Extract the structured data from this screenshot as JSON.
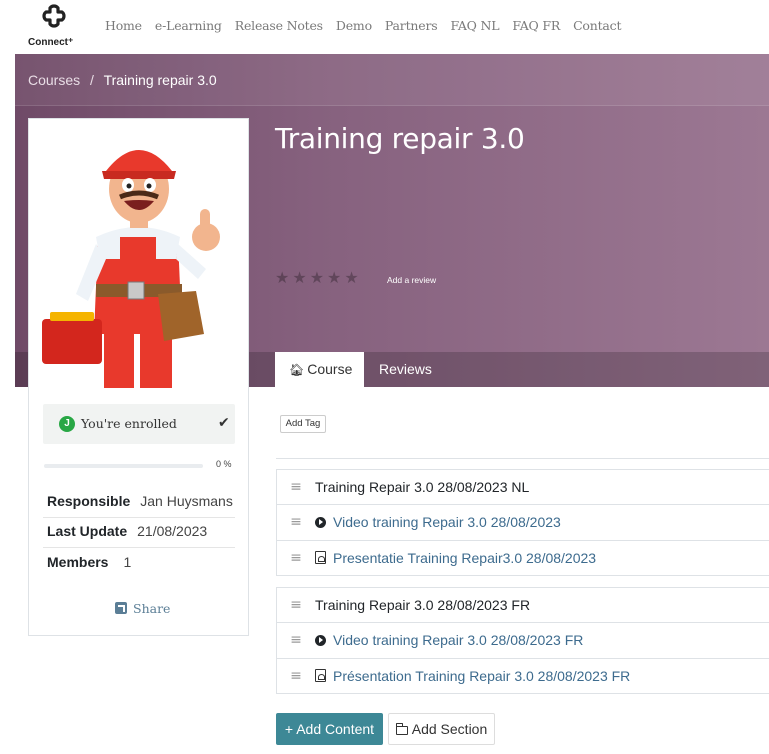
{
  "brand": {
    "logo_text": "Connect⁺"
  },
  "nav": {
    "items": [
      "Home",
      "e-Learning",
      "Release Notes",
      "Demo",
      "Partners",
      "FAQ NL",
      "FAQ FR",
      "Contact"
    ]
  },
  "breadcrumb": {
    "parent": "Courses",
    "separator": "/",
    "current": "Training repair 3.0"
  },
  "course": {
    "title": "Training repair 3.0",
    "rating_stars": 0,
    "add_review_label": "Add a review"
  },
  "tabs": {
    "course": "Course",
    "reviews": "Reviews"
  },
  "sidebar": {
    "enrolled_badge": "J",
    "enrolled_label": "You're enrolled",
    "progress_percent": 0,
    "progress_label": "0 %",
    "responsible_key": "Responsible",
    "responsible_val": "Jan Huysmans",
    "last_update_key": "Last Update",
    "last_update_val": "21/08/2023",
    "members_key": "Members",
    "members_val": "1",
    "share_label": "Share"
  },
  "content": {
    "add_tag_label": "Add Tag",
    "sections": [
      {
        "title": "Training Repair 3.0 28/08/2023 NL",
        "items": [
          {
            "type": "video",
            "icon": "play-circle-icon",
            "title": "Video training Repair 3.0 28/08/2023"
          },
          {
            "type": "pdf",
            "icon": "pdf-file-icon",
            "title": "Presentatie Training Repair3.0 28/08/2023"
          }
        ]
      },
      {
        "title": "Training Repair 3.0 28/08/2023 FR",
        "items": [
          {
            "type": "video",
            "icon": "play-circle-icon",
            "title": "Video training Repair 3.0 28/08/2023 FR"
          },
          {
            "type": "pdf",
            "icon": "pdf-file-icon",
            "title": "Présentation Training Repair 3.0 28/08/2023 FR"
          }
        ]
      }
    ],
    "add_content_label": "+ Add Content",
    "add_section_label": "Add Section"
  },
  "colors": {
    "hero": "#7d5674",
    "link": "#3d6b8e",
    "primary_button": "#3d8896",
    "enrolled_badge": "#28a745"
  }
}
